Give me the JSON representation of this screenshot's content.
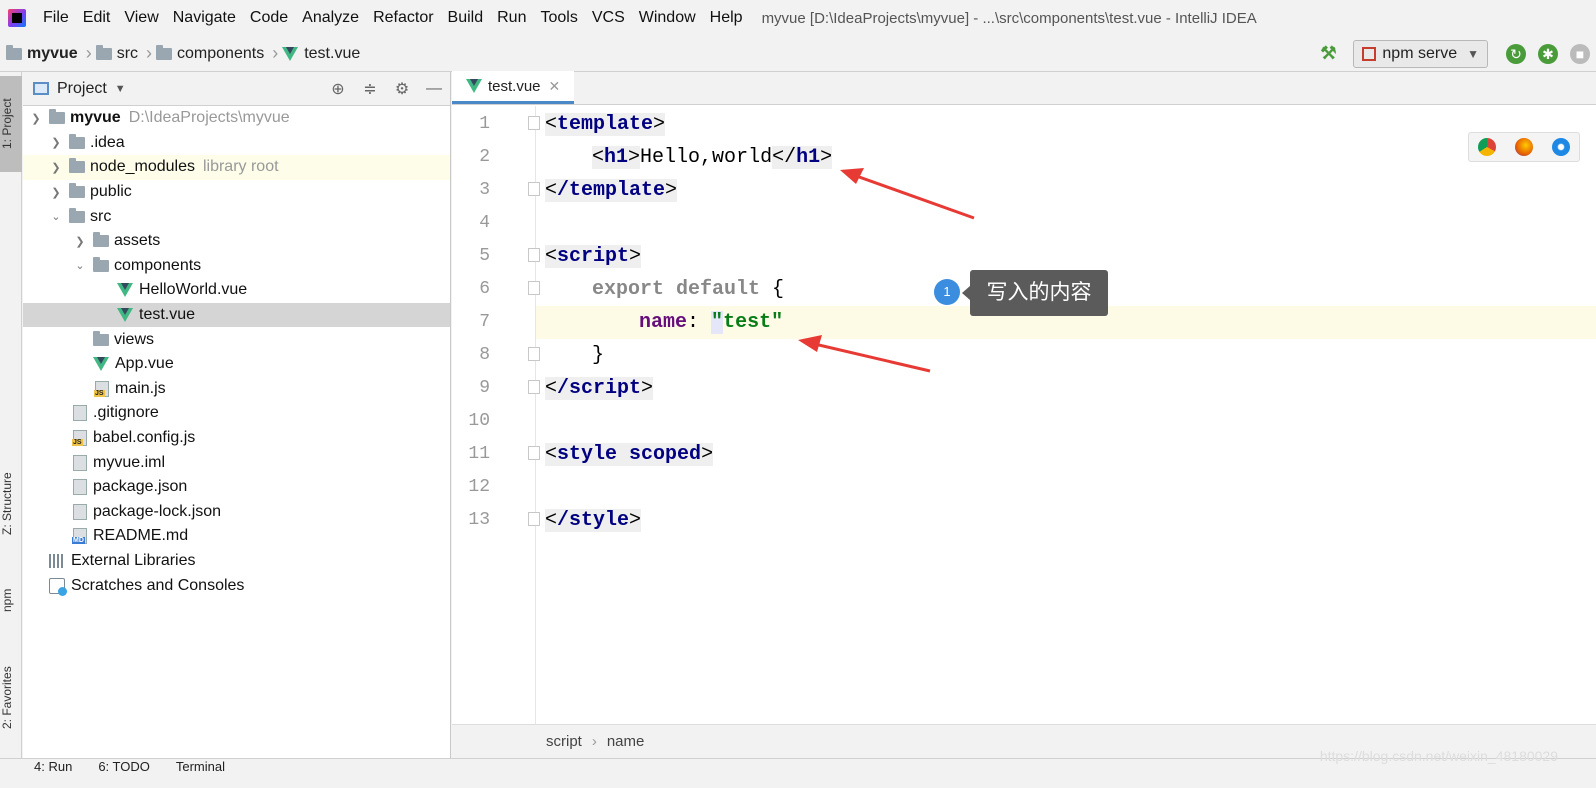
{
  "menubar": {
    "items": [
      {
        "letter": "F",
        "rest": "ile"
      },
      {
        "letter": "E",
        "rest": "dit"
      },
      {
        "letter": "V",
        "rest": "iew"
      },
      {
        "letter": "N",
        "rest": "avigate"
      },
      {
        "letter": "C",
        "rest": "ode"
      },
      {
        "letter": "",
        "rest": "Analy"
      },
      {
        "letter": "R",
        "rest": "efactor"
      },
      {
        "letter": "B",
        "rest": "uild"
      },
      {
        "letter": "R",
        "rest": "un"
      },
      {
        "letter": "T",
        "rest": "ools"
      },
      {
        "letter": "",
        "rest": "VCS"
      },
      {
        "letter": "W",
        "rest": "indow"
      },
      {
        "letter": "H",
        "rest": "elp"
      }
    ],
    "labels": [
      "File",
      "Edit",
      "View",
      "Navigate",
      "Code",
      "Analyze",
      "Refactor",
      "Build",
      "Run",
      "Tools",
      "VCS",
      "Window",
      "Help"
    ],
    "window_title": "myvue [D:\\IdeaProjects\\myvue] - ...\\src\\components\\test.vue - IntelliJ IDEA"
  },
  "navbar": {
    "crumbs": [
      "myvue",
      "src",
      "components",
      "test.vue"
    ],
    "run_config": "npm serve"
  },
  "left_strip": {
    "tabs": [
      "1: Project",
      "Z: Structure",
      "npm",
      "2: Favorites"
    ]
  },
  "project_panel": {
    "title": "Project",
    "tree": [
      {
        "label": "myvue",
        "hint": "D:\\IdeaProjects\\myvue"
      },
      {
        "label": ".idea"
      },
      {
        "label": "node_modules",
        "hint": "library root"
      },
      {
        "label": "public"
      },
      {
        "label": "src"
      },
      {
        "label": "assets"
      },
      {
        "label": "components"
      },
      {
        "label": "HelloWorld.vue"
      },
      {
        "label": "test.vue"
      },
      {
        "label": "views"
      },
      {
        "label": "App.vue"
      },
      {
        "label": "main.js"
      },
      {
        "label": ".gitignore"
      },
      {
        "label": "babel.config.js"
      },
      {
        "label": "myvue.iml"
      },
      {
        "label": "package.json"
      },
      {
        "label": "package-lock.json"
      },
      {
        "label": "README.md"
      },
      {
        "label": "External Libraries"
      },
      {
        "label": "Scratches and Consoles"
      }
    ],
    "file_tags": {
      "js": "JS",
      "md": "MD"
    }
  },
  "editor": {
    "tab_label": "test.vue",
    "line_numbers": [
      "1",
      "2",
      "3",
      "4",
      "5",
      "6",
      "7",
      "8",
      "9",
      "10",
      "11",
      "12",
      "13"
    ],
    "code": {
      "l1_tag": "template",
      "l2_h1": "h1",
      "l2_text": "Hello,world",
      "l3_tag": "/template",
      "l5_tag": "script",
      "l6_kw": "export default",
      "l6_brace": "{",
      "l7_prop": "name",
      "l7_colon": ":",
      "l7_str": "\"test\"",
      "l8_brace": "}",
      "l9_tag": "/script",
      "l11_tag": "style",
      "l11_attr": "scoped",
      "l13_tag": "/style"
    },
    "status_path": [
      "script",
      "name"
    ]
  },
  "annotation": {
    "badge": "1",
    "text": "写入的内容",
    "arrow_color": "#e83a35"
  },
  "bottombar": {
    "tabs": [
      "4: Run",
      "6: TODO",
      "Terminal"
    ]
  },
  "watermark": "https://blog.csdn.net/weixin_48180029"
}
